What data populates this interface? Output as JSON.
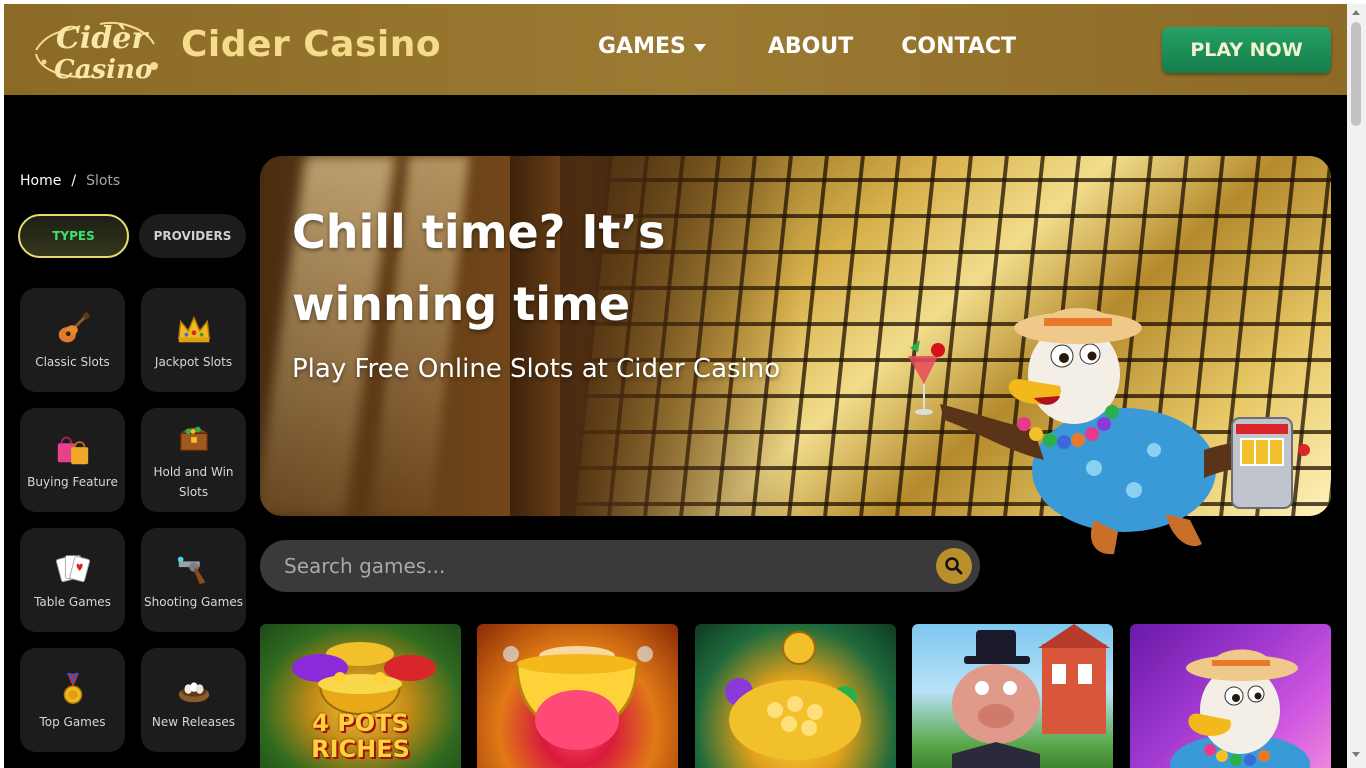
{
  "header": {
    "logo_text_line1": "Cidèr",
    "logo_text_line2": "Casino",
    "brand": "Cider Casino",
    "nav": [
      {
        "label": "GAMES",
        "has_dropdown": true
      },
      {
        "label": "ABOUT"
      },
      {
        "label": "CONTACT"
      }
    ],
    "cta": "PLAY NOW"
  },
  "breadcrumb": {
    "home": "Home",
    "separator": "/",
    "current": "Slots"
  },
  "filters": {
    "types": "TYPES",
    "providers": "PROVIDERS",
    "active": "types"
  },
  "categories": [
    {
      "label": "Classic Slots",
      "icon": "guitar-icon"
    },
    {
      "label": "Jackpot Slots",
      "icon": "crown-icon"
    },
    {
      "label": "Buying Feature",
      "icon": "shopping-bags-icon"
    },
    {
      "label": "Hold and Win Slots",
      "icon": "treasure-chest-icon"
    },
    {
      "label": "Table Games",
      "icon": "playing-cards-icon"
    },
    {
      "label": "Shooting Games",
      "icon": "revolver-icon"
    },
    {
      "label": "Top Games",
      "icon": "medal-icon"
    },
    {
      "label": "New Releases",
      "icon": "nest-eggs-icon"
    }
  ],
  "hero": {
    "title": "Chill time? It’s winning time",
    "subtitle": "Play Free Online Slots at Cider Casino"
  },
  "search": {
    "placeholder": "Search games..."
  },
  "games": [
    {
      "title_line1": "4 POTS",
      "title_line2": "RICHES",
      "icon": "pots-of-gold-icon"
    },
    {
      "icon": "cauldron-icon"
    },
    {
      "icon": "pot-of-gold-clover-icon"
    },
    {
      "icon": "pig-tycoon-icon"
    },
    {
      "icon": "eagle-mascot-icon"
    }
  ],
  "colors": {
    "header_gold": "#9b7a32",
    "brand_text": "#f4dc8b",
    "cta_green": "#1f9459",
    "page_bg": "#000000",
    "tile_bg": "#1c1c1c",
    "active_toggle_border": "#e2dc73",
    "active_toggle_text": "#39e36c",
    "search_button": "#b9902c"
  }
}
